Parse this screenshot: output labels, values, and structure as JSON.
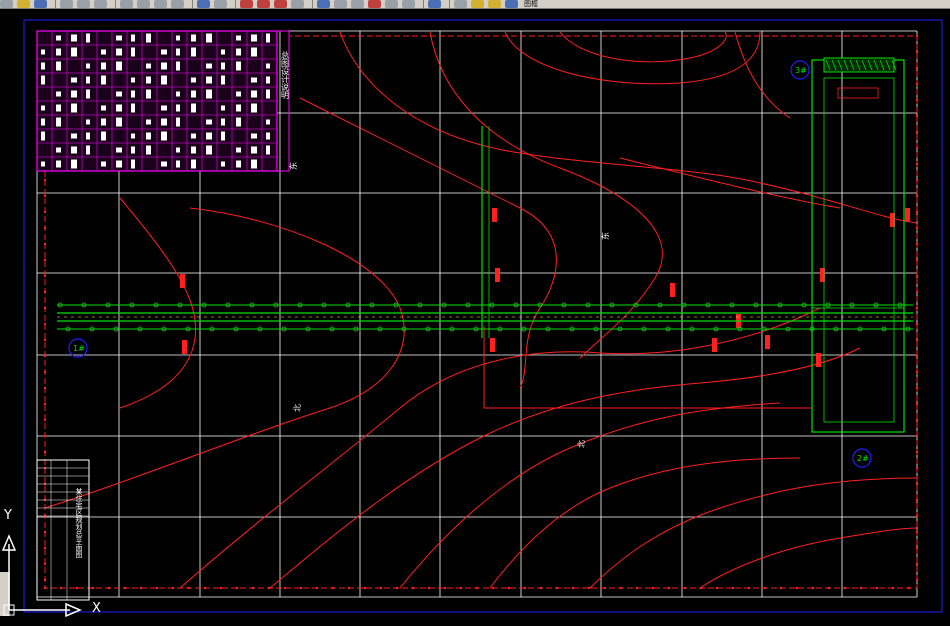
{
  "app": {
    "toolbar_text": "图框"
  },
  "ucs": {
    "x_label": "X",
    "y_label": "Y"
  },
  "drawing": {
    "table_title": "总图设计说明",
    "title_block_text": "某住宅区规划总平面图",
    "markers": [
      "1#",
      "2#",
      "3#"
    ],
    "labels": [
      "北",
      "东"
    ]
  },
  "colors": {
    "background": "#000000",
    "grid": "#ffffff",
    "contour": "#ff2020",
    "road": "#00e000",
    "table": "#ff00ff",
    "frame": "#2020ff"
  }
}
